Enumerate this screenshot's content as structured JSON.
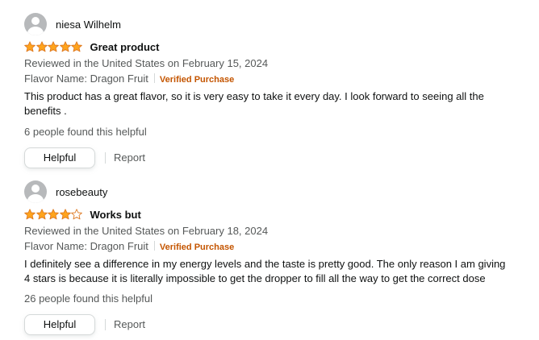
{
  "colors": {
    "star_fill": "#ffa41c",
    "star_stroke": "#de7921",
    "verified": "#c45500",
    "muted_text": "#565959"
  },
  "reviews": [
    {
      "profile_name": "niesa Wilhelm",
      "rating": 5,
      "rating_max": 5,
      "title": "Great product",
      "date": "Reviewed in the United States on February 15, 2024",
      "flavor": "Flavor Name: Dragon Fruit",
      "verified": "Verified Purchase",
      "body": "This product has a great flavor, so it is very easy to take it every day. I look forward to seeing all the benefits .",
      "helpful_count": "6 people found this helpful",
      "helpful_label": "Helpful",
      "report_label": "Report"
    },
    {
      "profile_name": "rosebeauty",
      "rating": 4,
      "rating_max": 5,
      "title": "Works but",
      "date": "Reviewed in the United States on February 18, 2024",
      "flavor": "Flavor Name: Dragon Fruit",
      "verified": "Verified Purchase",
      "body": "I definitely see a difference in my energy levels and the taste is pretty good. The only reason I am giving 4 stars is because it is literally impossible to get the dropper to fill all the way to get the correct dose",
      "helpful_count": "26 people found this helpful",
      "helpful_label": "Helpful",
      "report_label": "Report"
    }
  ]
}
